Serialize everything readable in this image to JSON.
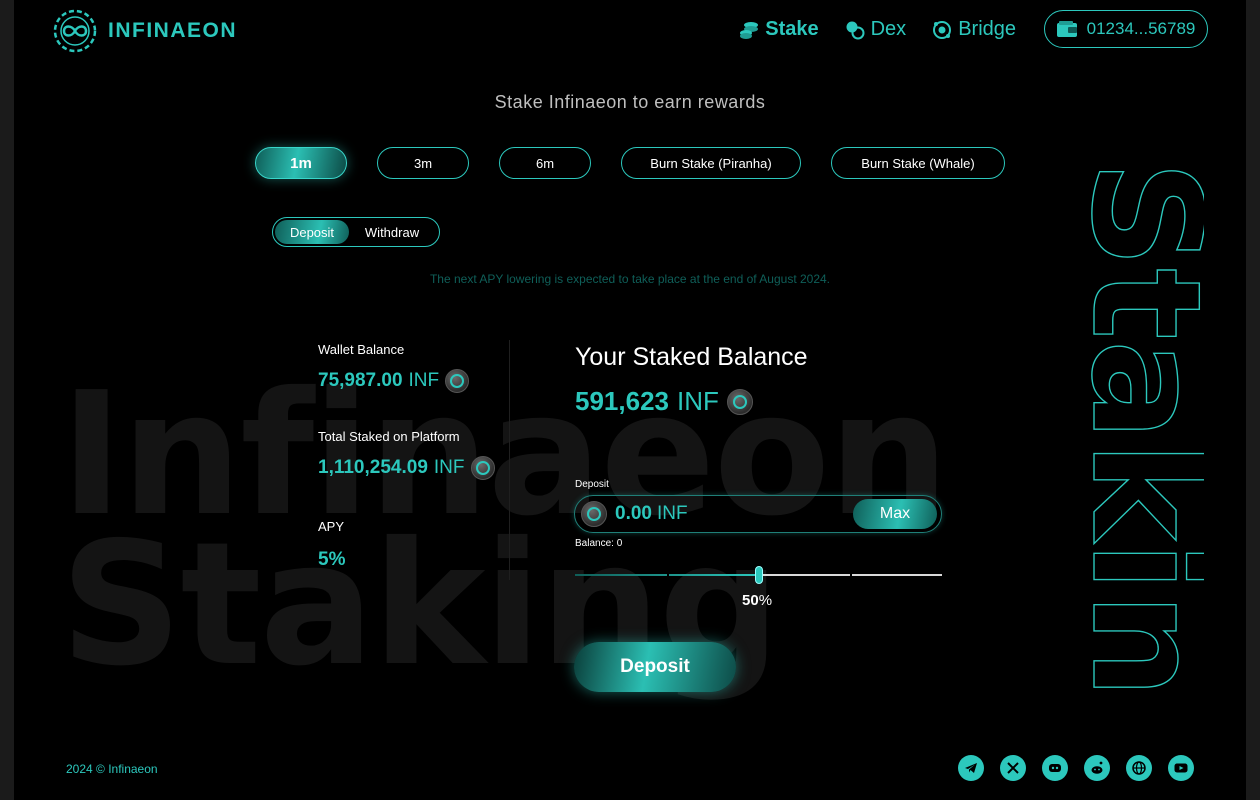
{
  "brand": {
    "name": "INFINAEON"
  },
  "nav": {
    "items": [
      {
        "label": "Stake",
        "icon": "stack-coins-icon",
        "active": true
      },
      {
        "label": "Dex",
        "icon": "exchange-icon",
        "active": false
      },
      {
        "label": "Bridge",
        "icon": "bridge-icon",
        "active": false
      }
    ],
    "wallet_address": "01234...56789"
  },
  "headline": "Stake Infinaeon to earn rewards",
  "periods": [
    "1m",
    "3m",
    "6m",
    "Burn Stake (Piranha)",
    "Burn Stake (Whale)"
  ],
  "active_period": "1m",
  "mode_toggle": {
    "deposit": "Deposit",
    "withdraw": "Withdraw",
    "active": "Deposit"
  },
  "notice": "The next APY lowering is expected to take place at the end of August 2024.",
  "stats": {
    "wallet_balance": {
      "label": "Wallet Balance",
      "amount": "75,987.00",
      "unit": "INF"
    },
    "total_staked": {
      "label": "Total Staked on Platform",
      "amount": "1,110,254.09",
      "unit": "INF"
    },
    "apy": {
      "label": "APY",
      "value": "5%"
    }
  },
  "staked": {
    "title": "Your Staked Balance",
    "amount": "591,623",
    "unit": "INF"
  },
  "deposit_form": {
    "label": "Deposit",
    "amount": "0.00",
    "unit": "INF",
    "max_label": "Max",
    "balance_text": "Balance: 0",
    "slider_percent": 50,
    "slider_label_value": "50",
    "slider_label_unit": "%",
    "submit_label": "Deposit"
  },
  "watermark": {
    "left_line1": "Infinaeon",
    "left_line2": "Staking",
    "right": "Staking"
  },
  "footer": {
    "copyright": "2024 © Infinaeon",
    "socials": [
      "telegram-icon",
      "x-icon",
      "discord-icon",
      "reddit-icon",
      "globe-icon",
      "youtube-icon"
    ]
  },
  "colors": {
    "accent": "#2cc8bd",
    "background": "#000000"
  }
}
